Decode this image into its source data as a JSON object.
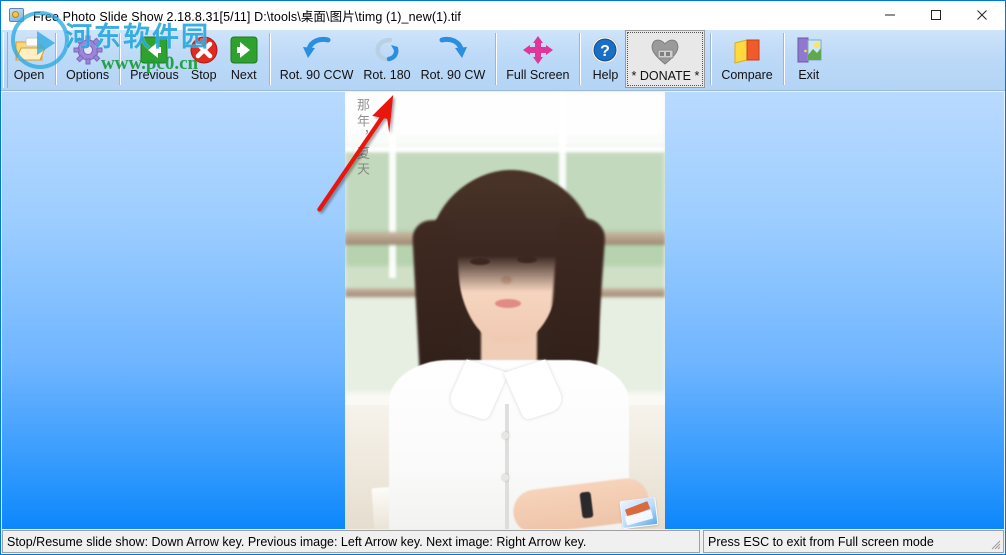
{
  "window": {
    "title": "Free Photo Slide Show 2.18.8.31[5/11] D:\\tools\\桌面\\图片\\timg (1)_new(1).tif",
    "icon": "app-photo-icon",
    "controls": {
      "minimize": "—",
      "maximize": "☐",
      "close": "✕"
    }
  },
  "toolbar": {
    "buttons": [
      {
        "label": "Open",
        "icon": "folder-open-icon",
        "pressed": false
      },
      {
        "label": "Options",
        "icon": "gear-icon",
        "pressed": false
      },
      {
        "label": "Previous",
        "icon": "green-left-arrow-icon",
        "pressed": false
      },
      {
        "label": "Stop",
        "icon": "red-x-circle-icon",
        "pressed": false
      },
      {
        "label": "Next",
        "icon": "green-right-arrow-icon",
        "pressed": false
      },
      {
        "label": "Rot. 90 CCW",
        "icon": "rotate-ccw-icon",
        "pressed": false
      },
      {
        "label": "Rot. 180",
        "icon": "rotate-180-icon",
        "pressed": false
      },
      {
        "label": "Rot. 90 CW",
        "icon": "rotate-cw-icon",
        "pressed": false
      },
      {
        "label": "Full Screen",
        "icon": "four-way-arrows-icon",
        "pressed": false
      },
      {
        "label": "Help",
        "icon": "question-circle-icon",
        "pressed": false
      },
      {
        "label": "* DONATE *",
        "icon": "heart-donate-icon",
        "pressed": true
      },
      {
        "label": "Compare",
        "icon": "two-cards-icon",
        "pressed": false
      },
      {
        "label": "Exit",
        "icon": "door-exit-icon",
        "pressed": false
      }
    ]
  },
  "photo": {
    "overlay_text": "那年，夏天",
    "badge_icon": "photo-watermark-badge-icon",
    "annotation_arrow": "red-pointer-arrow"
  },
  "watermark": {
    "site_name": "河东软件园",
    "url": "www.pc0.cn",
    "logo_icon": "play-circle-logo-icon"
  },
  "statusbar": {
    "left_text": "Stop/Resume slide show: Down Arrow key. Previous image: Left Arrow key. Next image: Right Arrow key.",
    "right_text": "Press ESC to exit from Full screen mode"
  },
  "colors": {
    "toolbar_top": "#cfe4fb",
    "toolbar_bottom": "#b4d4f6",
    "canvas_top": "#b9daff",
    "canvas_bottom": "#0b87fb",
    "accent_blue": "#0078d7",
    "annotation_red": "#e8120e",
    "watermark_cyan": "#2aa8e0",
    "watermark_green": "#1f9e3f"
  }
}
